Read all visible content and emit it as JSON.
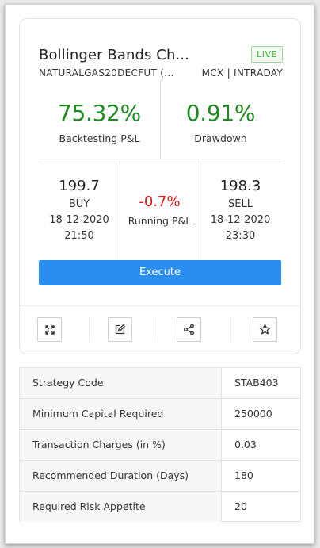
{
  "card": {
    "title": "Bollinger Bands Ch...",
    "status_badge": "LIVE",
    "instrument": "NATURALGAS20DECFUT (...",
    "exchange_segment": "MCX | INTRADAY",
    "backtesting_pnl": {
      "value": "75.32%",
      "label": "Backtesting P&L"
    },
    "drawdown": {
      "value": "0.91%",
      "label": "Drawdown"
    },
    "buy": {
      "price": "199.7",
      "side": "BUY",
      "date": "18-12-2020",
      "time": "21:50"
    },
    "running_pnl": {
      "value": "-0.7%",
      "label": "Running P&L"
    },
    "sell": {
      "price": "198.3",
      "side": "SELL",
      "date": "18-12-2020",
      "time": "23:30"
    },
    "execute_label": "Execute",
    "actions": [
      "expand-icon",
      "edit-icon",
      "share-icon",
      "star-icon"
    ]
  },
  "details": [
    {
      "key": "Strategy Code",
      "value": "STAB403"
    },
    {
      "key": "Minimum Capital Required",
      "value": "250000"
    },
    {
      "key": "Transaction Charges (in %)",
      "value": "0.03"
    },
    {
      "key": "Recommended Duration (Days)",
      "value": "180"
    },
    {
      "key": "Required Risk Appetite",
      "value": "20"
    }
  ],
  "colors": {
    "positive": "#1f8a1f",
    "negative": "#e01919",
    "primary_button": "#2a8ef0",
    "live_badge": "#35b535"
  }
}
